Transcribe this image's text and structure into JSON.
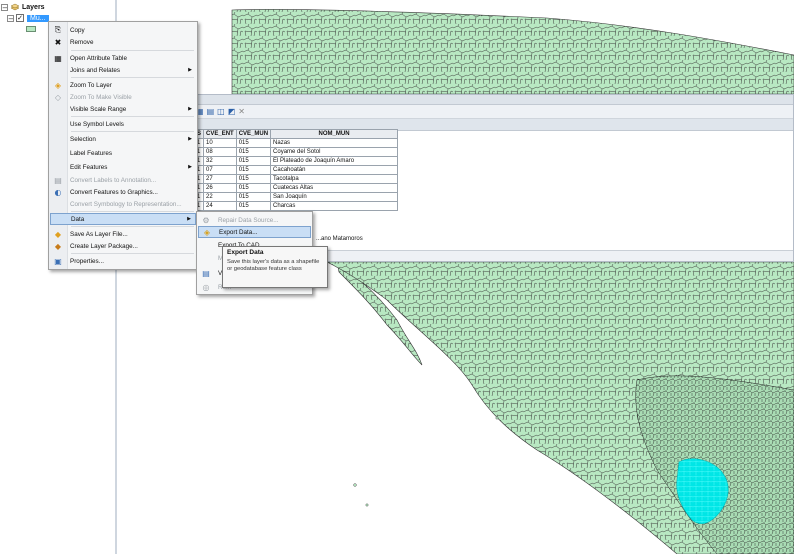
{
  "toc": {
    "root_label": "Layers",
    "layer_name": "Mu..."
  },
  "menu": {
    "items": [
      {
        "label": "Copy",
        "icon": "copy-icon",
        "glyph": "⎘"
      },
      {
        "label": "Remove",
        "icon": "remove-icon",
        "glyph": "✖"
      },
      {
        "label": "Open Attribute Table",
        "icon": "table-icon",
        "glyph": "▦"
      },
      {
        "label": "Joins and Relates",
        "icon": "",
        "glyph": ""
      },
      {
        "label": "Zoom To Layer",
        "icon": "zoom-to-layer-icon",
        "glyph": "◈"
      },
      {
        "label": "Zoom To Make Visible",
        "icon": "zoom-visible-icon",
        "glyph": "◇"
      },
      {
        "label": "Visible Scale Range",
        "icon": "",
        "glyph": ""
      },
      {
        "label": "Use Symbol Levels",
        "icon": "",
        "glyph": ""
      },
      {
        "label": "Selection",
        "icon": "",
        "glyph": ""
      },
      {
        "label": "Label Features",
        "icon": "",
        "glyph": ""
      },
      {
        "label": "Edit Features",
        "icon": "",
        "glyph": ""
      },
      {
        "label": "Convert Labels to Annotation...",
        "icon": "annotation-icon",
        "glyph": "▤"
      },
      {
        "label": "Convert Features to Graphics...",
        "icon": "graphics-icon",
        "glyph": "◐"
      },
      {
        "label": "Convert Symbology to Representation...",
        "icon": "",
        "glyph": ""
      },
      {
        "label": "Data",
        "icon": "",
        "glyph": ""
      },
      {
        "label": "Save As Layer File...",
        "icon": "layer-file-icon",
        "glyph": "◆"
      },
      {
        "label": "Create Layer Package...",
        "icon": "package-icon",
        "glyph": "◆"
      },
      {
        "label": "Properties...",
        "icon": "properties-icon",
        "glyph": "▣"
      }
    ]
  },
  "submenu": {
    "items": [
      {
        "label": "Repair Data Source..."
      },
      {
        "label": "Export Data..."
      },
      {
        "label": "Export To CAD..."
      },
      {
        "label": "Ma..."
      },
      {
        "label": "Vie..."
      },
      {
        "label": "Re..."
      }
    ]
  },
  "tooltip": {
    "title": "Export Data",
    "body": "Save this layer's data as a shapefile or geodatabase feature class"
  },
  "table": {
    "columns": [
      "S",
      "CVE_ENT",
      "CVE_MUN",
      "NOM_MUN"
    ],
    "rows": [
      [
        "1",
        "10",
        "015",
        "Nazas"
      ],
      [
        "1",
        "08",
        "015",
        "Coyame del Sotol"
      ],
      [
        "1",
        "32",
        "015",
        "El Plateado de Joaquín Amaro"
      ],
      [
        "1",
        "07",
        "015",
        "Cacahoatán"
      ],
      [
        "1",
        "27",
        "015",
        "Tacotalpa"
      ],
      [
        "1",
        "26",
        "015",
        "Cuatecas Altas"
      ],
      [
        "1",
        "22",
        "015",
        "San Joaquín"
      ],
      [
        "1",
        "24",
        "015",
        "Charcas"
      ]
    ],
    "partial_cell": "...ano Matamoros"
  },
  "colors": {
    "land": "#b8e8c2",
    "selected": "#00e6e6",
    "highlight": "#c9def5"
  }
}
